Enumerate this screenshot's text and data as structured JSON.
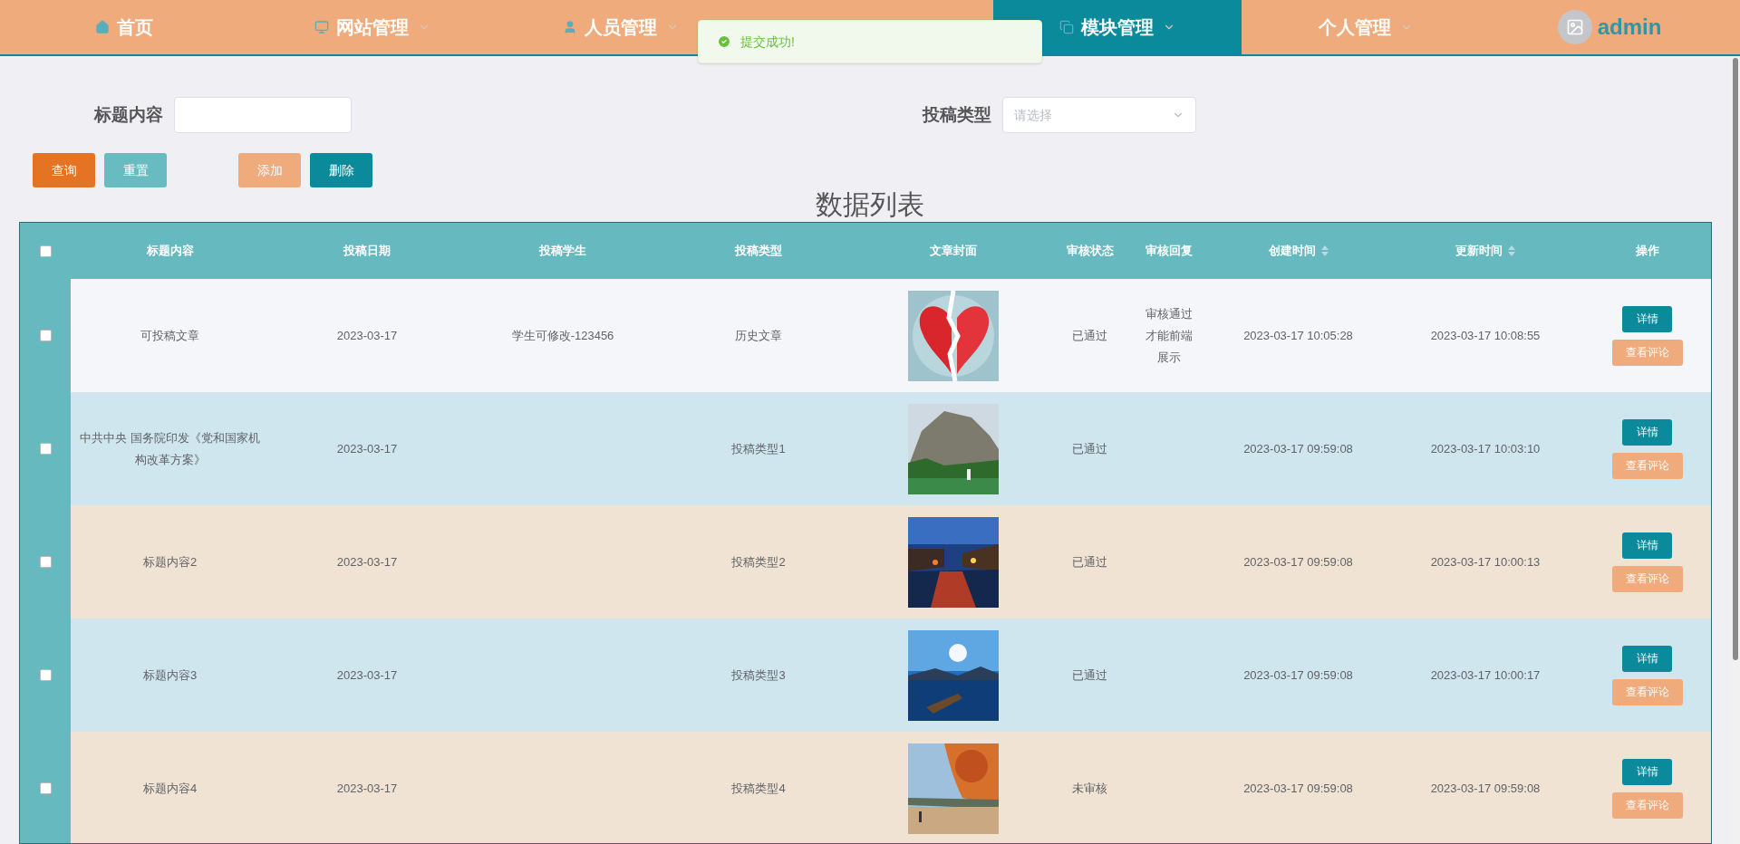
{
  "nav": {
    "items": [
      {
        "label": "首页",
        "kind": "home",
        "has_dropdown": false,
        "selected": false
      },
      {
        "label": "网站管理",
        "kind": "monitor",
        "has_dropdown": true,
        "selected": false
      },
      {
        "label": "人员管理",
        "kind": "user",
        "has_dropdown": true,
        "selected": false
      },
      {
        "label": "模块管理",
        "kind": "copy",
        "has_dropdown": true,
        "selected": true
      },
      {
        "label": "个人管理",
        "kind": "text",
        "has_dropdown": true,
        "selected": false
      }
    ],
    "user": {
      "name": "admin"
    }
  },
  "toast": {
    "message": "提交成功!"
  },
  "filters": [
    {
      "kind": "input",
      "label": "标题内容"
    },
    {
      "kind": "select",
      "label": "投稿类型",
      "placeholder": "请选择"
    }
  ],
  "buttons": [
    {
      "label": "查询",
      "kind": "search"
    },
    {
      "label": "重置",
      "kind": "reset"
    },
    {
      "label": "添加",
      "kind": "add"
    },
    {
      "label": "删除",
      "kind": "delete"
    }
  ],
  "table": {
    "title": "数据列表",
    "select_all": {
      "checked": false
    },
    "columns": [
      {
        "label": "标题内容",
        "sortable": false
      },
      {
        "label": "投稿日期",
        "sortable": false
      },
      {
        "label": "投稿学生",
        "sortable": false
      },
      {
        "label": "投稿类型",
        "sortable": false
      },
      {
        "label": "文章封面",
        "sortable": false
      },
      {
        "label": "审核状态",
        "sortable": false
      },
      {
        "label": "审核回复",
        "sortable": false
      },
      {
        "label": "创建时间",
        "sortable": true
      },
      {
        "label": "更新时间",
        "sortable": true
      },
      {
        "label": "操作",
        "sortable": false
      }
    ],
    "rows": [
      {
        "checked": false,
        "title": "可投稿文章",
        "date": "2023-03-17",
        "student": "学生可修改-123456",
        "type": "历史文章",
        "status": "已通过",
        "reply": "审核通过才能前端展示",
        "created": "2023-03-17 10:05:28",
        "updated": "2023-03-17 10:08:55",
        "actions": [
          "详情",
          "查看评论"
        ]
      },
      {
        "checked": false,
        "title": "中共中央 国务院印发《党和国家机构改革方案》",
        "date": "2023-03-17",
        "student": "",
        "type": "投稿类型1",
        "status": "已通过",
        "reply": "",
        "created": "2023-03-17 09:59:08",
        "updated": "2023-03-17 10:03:10",
        "actions": [
          "详情",
          "查看评论"
        ]
      },
      {
        "checked": false,
        "title": "标题内容2",
        "date": "2023-03-17",
        "student": "",
        "type": "投稿类型2",
        "status": "已通过",
        "reply": "",
        "created": "2023-03-17 09:59:08",
        "updated": "2023-03-17 10:00:13",
        "actions": [
          "详情",
          "查看评论"
        ]
      },
      {
        "checked": false,
        "title": "标题内容3",
        "date": "2023-03-17",
        "student": "",
        "type": "投稿类型3",
        "status": "已通过",
        "reply": "",
        "created": "2023-03-17 09:59:08",
        "updated": "2023-03-17 10:00:17",
        "actions": [
          "详情",
          "查看评论"
        ]
      },
      {
        "checked": false,
        "title": "标题内容4",
        "date": "2023-03-17",
        "student": "",
        "type": "投稿类型4",
        "status": "未审核",
        "reply": "",
        "created": "2023-03-17 09:59:08",
        "updated": "2023-03-17 09:59:08",
        "actions": [
          "详情",
          "查看评论"
        ]
      }
    ]
  }
}
